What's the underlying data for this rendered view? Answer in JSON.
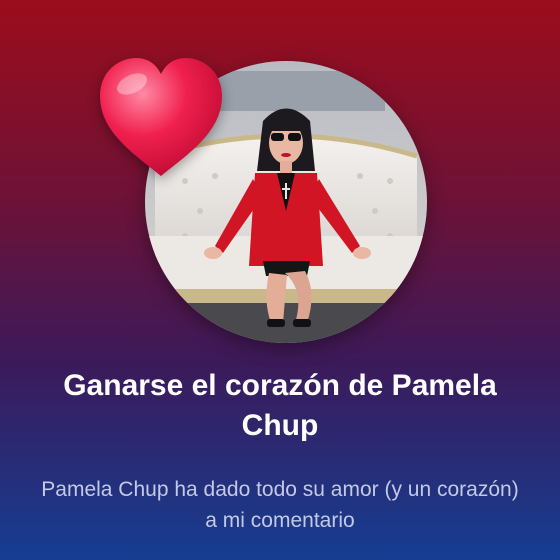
{
  "achievement": {
    "title": "Ganarse el corazón de Pamela Chup",
    "description": "Pamela Chup ha dado todo su amor (y un corazón) a mi comentario"
  },
  "colors": {
    "background_top": "#9b0d1c",
    "background_bottom": "#153e92",
    "title_text": "#ffffff",
    "description_text": "#c4c9e6",
    "heart": "#f0204e"
  },
  "icons": {
    "badge": "heart-icon"
  }
}
